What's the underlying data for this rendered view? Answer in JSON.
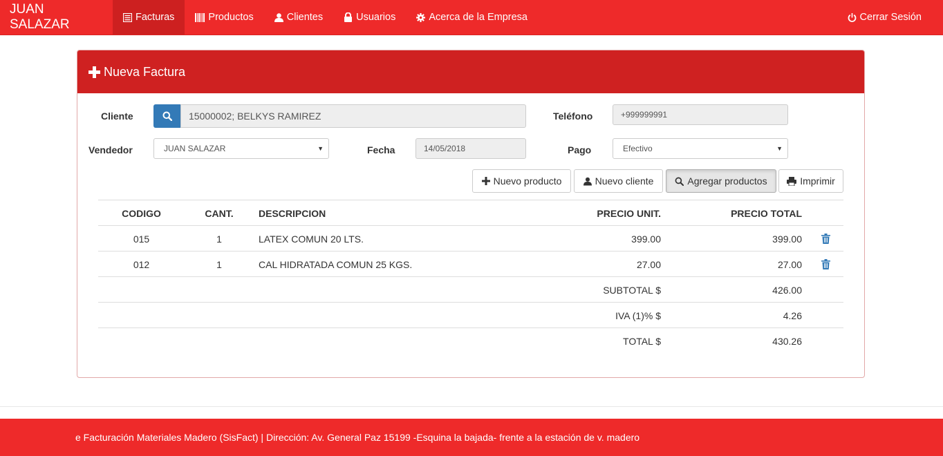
{
  "navbar": {
    "brand": "JUAN SALAZAR",
    "items": [
      {
        "label": "Facturas",
        "icon": "list-alt-icon",
        "active": true
      },
      {
        "label": "Productos",
        "icon": "barcode-icon"
      },
      {
        "label": "Clientes",
        "icon": "user-icon"
      },
      {
        "label": "Usuarios",
        "icon": "lock-icon"
      },
      {
        "label": "Acerca de la Empresa",
        "icon": "cog-icon"
      }
    ],
    "logout": {
      "label": "Cerrar Sesión",
      "icon": "power-icon"
    }
  },
  "panel": {
    "title": "Nueva Factura",
    "title_icon": "plus-icon"
  },
  "form": {
    "cliente_label": "Cliente",
    "cliente_value": "15000002; BELKYS RAMIREZ",
    "telefono_label": "Teléfono",
    "telefono_value": "+999999991",
    "vendedor_label": "Vendedor",
    "vendedor_value": "JUAN SALAZAR",
    "fecha_label": "Fecha",
    "fecha_value": "14/05/2018",
    "pago_label": "Pago",
    "pago_value": "Efectivo"
  },
  "buttons": {
    "nuevo_producto": "Nuevo producto",
    "nuevo_cliente": "Nuevo cliente",
    "agregar_productos": "Agregar productos",
    "imprimir": "Imprimir"
  },
  "table": {
    "headers": {
      "codigo": "CODIGO",
      "cant": "CANT.",
      "descripcion": "DESCRIPCION",
      "precio_unit": "PRECIO UNIT.",
      "precio_total": "PRECIO TOTAL"
    },
    "rows": [
      {
        "codigo": "015",
        "cant": "1",
        "descripcion": "LATEX COMUN 20 LTS.",
        "precio_unit": "399.00",
        "precio_total": "399.00"
      },
      {
        "codigo": "012",
        "cant": "1",
        "descripcion": "CAL HIDRATADA COMUN 25 KGS.",
        "precio_unit": "27.00",
        "precio_total": "27.00"
      }
    ],
    "totals": [
      {
        "label": "SUBTOTAL $",
        "value": "426.00"
      },
      {
        "label": "IVA (1)% $",
        "value": "4.26"
      },
      {
        "label": "TOTAL $",
        "value": "430.26"
      }
    ]
  },
  "footer": {
    "text": "e Facturación Materiales Madero (SisFact) | Dirección: Av. General Paz 15199 -Esquina la bajada- frente a la estación de v. madero"
  },
  "colors": {
    "brand_red": "#ee2a2a",
    "panel_red": "#cf2121",
    "primary_blue": "#337ab7"
  }
}
